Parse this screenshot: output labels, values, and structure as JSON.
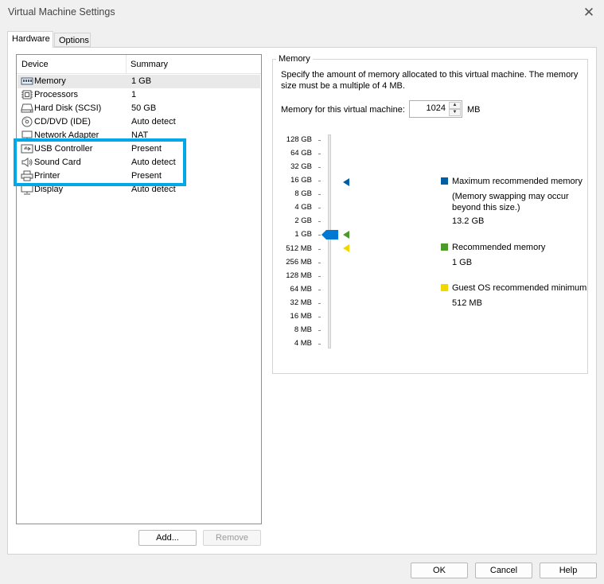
{
  "window": {
    "title": "Virtual Machine Settings"
  },
  "tabs": [
    {
      "label": "Hardware",
      "active": true
    },
    {
      "label": "Options",
      "active": false
    }
  ],
  "device_list": {
    "columns": [
      "Device",
      "Summary"
    ],
    "rows": [
      {
        "device": "Memory",
        "summary": "1 GB",
        "icon": "memory-icon",
        "selected": true
      },
      {
        "device": "Processors",
        "summary": "1",
        "icon": "processor-icon"
      },
      {
        "device": "Hard Disk (SCSI)",
        "summary": "50 GB",
        "icon": "hard-disk-icon"
      },
      {
        "device": "CD/DVD (IDE)",
        "summary": "Auto detect",
        "icon": "cd-dvd-icon"
      },
      {
        "device": "Network Adapter",
        "summary": "NAT",
        "icon": "network-adapter-icon"
      },
      {
        "device": "USB Controller",
        "summary": "Present",
        "icon": "usb-icon"
      },
      {
        "device": "Sound Card",
        "summary": "Auto detect",
        "icon": "sound-card-icon"
      },
      {
        "device": "Printer",
        "summary": "Present",
        "icon": "printer-icon"
      },
      {
        "device": "Display",
        "summary": "Auto detect",
        "icon": "display-icon"
      }
    ]
  },
  "list_buttons": {
    "add": "Add...",
    "remove": "Remove"
  },
  "memory": {
    "group_title": "Memory",
    "description": "Specify the amount of memory allocated to this virtual machine. The memory size must be a multiple of 4 MB.",
    "field_label": "Memory for this virtual machine:",
    "field_value": "1024",
    "unit": "MB",
    "scale": [
      "128 GB",
      "64 GB",
      "32 GB",
      "16 GB",
      "8 GB",
      "4 GB",
      "2 GB",
      "1 GB",
      "512 MB",
      "256 MB",
      "128 MB",
      "64 MB",
      "32 MB",
      "16 MB",
      "8 MB",
      "4 MB"
    ],
    "slider_value": "1 GB",
    "legend": {
      "max": {
        "title": "Maximum recommended memory",
        "note": "(Memory swapping may occur beyond this size.)",
        "value": "13.2 GB",
        "color": "#005fa3"
      },
      "recommended": {
        "title": "Recommended memory",
        "value": "1 GB",
        "color": "#4c9a2a"
      },
      "minimum": {
        "title": "Guest OS recommended minimum",
        "value": "512 MB",
        "color": "#f2d600"
      }
    }
  },
  "dialog_buttons": {
    "ok": "OK",
    "cancel": "Cancel",
    "help": "Help"
  },
  "colors": {
    "accent": "#0078d4",
    "highlight": "#00a8e8"
  }
}
